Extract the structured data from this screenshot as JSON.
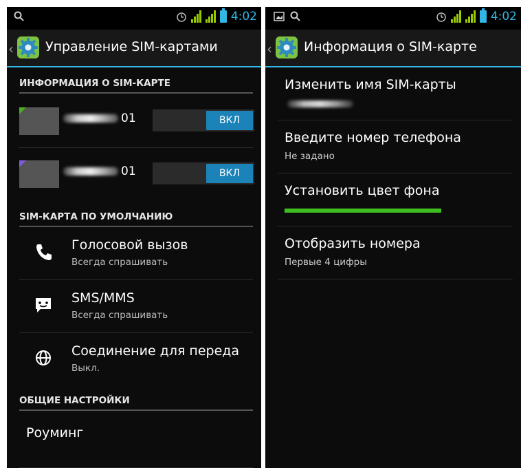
{
  "status_bar": {
    "time": "4:02"
  },
  "left": {
    "title": "Управление SIM-картами",
    "section_sim_info": "ИНФОРМАЦИЯ О SIM-КАРТЕ",
    "sims": [
      {
        "name_suffix": "01",
        "toggle": "ВКЛ",
        "color": "#4caf1f"
      },
      {
        "name_suffix": "01",
        "toggle": "ВКЛ",
        "color": "#7f5fd8"
      }
    ],
    "section_default": "SIM-КАРТА ПО УМОЛЧАНИЮ",
    "default_items": [
      {
        "title": "Голосовой вызов",
        "subtitle": "Всегда спрашивать",
        "icon": "phone-icon"
      },
      {
        "title": "SMS/MMS",
        "subtitle": "Всегда спрашивать",
        "icon": "sms-icon"
      },
      {
        "title": "Соединение для переда",
        "subtitle": "Выкл.",
        "icon": "globe-icon"
      }
    ],
    "section_general": "ОБЩИЕ НАСТРОЙКИ",
    "roaming": "Роуминг"
  },
  "right": {
    "title": "Информация о SIM-карте",
    "items": [
      {
        "title": "Изменить имя SIM-карты"
      },
      {
        "title": "Введите номер телефона",
        "subtitle": "Не задано"
      },
      {
        "title": "Установить цвет фона",
        "color": "#3fbf1f"
      },
      {
        "title": "Отобразить номера",
        "subtitle": "Первые 4 цифры"
      }
    ]
  },
  "colors": {
    "accent": "#33b5e5",
    "toggle_on": "#1c83b8"
  }
}
